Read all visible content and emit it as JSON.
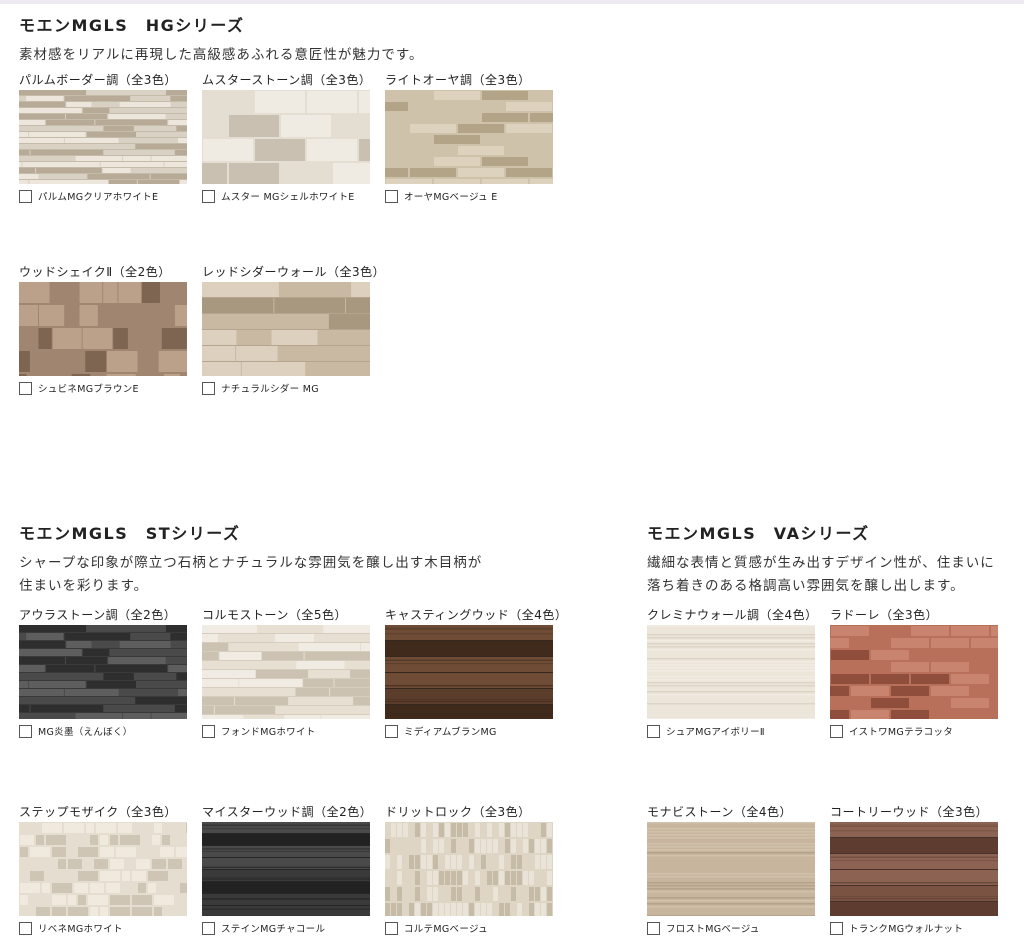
{
  "hg": {
    "title": "モエンMGLS　HGシリーズ",
    "desc_lines": [
      "素材感をリアルに再現した高級感あふれる意匠性が魅力です。"
    ],
    "rows": [
      [
        {
          "label": "パルムボーダー調（全3色）",
          "product": "パルムMGクリアホワイトE",
          "pattern": "palm",
          "colors": [
            "#d9d1c4",
            "#b7ab98",
            "#ece6dc"
          ]
        },
        {
          "label": "ムスターストーン調（全3色）",
          "product": "ムスター MGシェルホワイトE",
          "pattern": "stone",
          "colors": [
            "#e3ddd2",
            "#c9c0b2",
            "#efeae2"
          ]
        },
        {
          "label": "ライトオーヤ調（全3色）",
          "product": "オーヤMGベージュ E",
          "pattern": "oya",
          "colors": [
            "#cfc2aa",
            "#b3a488",
            "#ddd2bd"
          ]
        }
      ],
      [
        {
          "label": "ウッドシェイクⅡ（全2色）",
          "product": "シュビネMGブラウンE",
          "pattern": "shake",
          "colors": [
            "#a08670",
            "#7e6552",
            "#bba18a"
          ]
        },
        {
          "label": "レッドシダーウォール（全3色）",
          "product": "ナチュラルシダー MG",
          "pattern": "cedar",
          "colors": [
            "#c9b9a3",
            "#a89880",
            "#ddd0be"
          ]
        }
      ]
    ]
  },
  "st": {
    "title": "モエンMGLS　STシリーズ",
    "desc_lines": [
      "シャープな印象が際立つ石柄とナチュラルな雰囲気を醸し出す木目柄が",
      "住まいを彩ります。"
    ],
    "rows": [
      [
        {
          "label": "アウラストーン調（全2色）",
          "product": "MG炎墨（えんぼく）",
          "pattern": "aura",
          "colors": [
            "#4a4a4a",
            "#2e2e2e",
            "#5e5e5e"
          ]
        },
        {
          "label": "コルモストーン（全5色）",
          "product": "フォンドMGホワイト",
          "pattern": "corumo",
          "colors": [
            "#e6dfd2",
            "#cbc2b2",
            "#f1ece3"
          ]
        },
        {
          "label": "キャスティングウッド（全4色）",
          "product": "ミディアムブランMG",
          "pattern": "casting",
          "colors": [
            "#5a3d2a",
            "#3f2a1c",
            "#6e4c36"
          ]
        }
      ],
      [
        {
          "label": "ステップモザイク（全3色）",
          "product": "リベネMGホワイト",
          "pattern": "mosaic",
          "colors": [
            "#e4ddd0",
            "#cfc5b4",
            "#efe9de"
          ]
        },
        {
          "label": "マイスターウッド調（全2色）",
          "product": "ステインMGチャコール",
          "pattern": "meister",
          "colors": [
            "#3a3a3a",
            "#222222",
            "#4a4a4a"
          ]
        },
        {
          "label": "ドリットロック（全3色）",
          "product": "コルテMGベージュ",
          "pattern": "dolit",
          "colors": [
            "#ded5c5",
            "#c6bba7",
            "#eae3d7"
          ]
        }
      ]
    ]
  },
  "va": {
    "title": "モエンMGLS　VAシリーズ",
    "desc_lines": [
      "繊細な表情と質感が生み出すデザイン性が、住まいに",
      "落ち着きのある格調高い雰囲気を醸し出します。"
    ],
    "rows": [
      [
        {
          "label": "クレミナウォール調（全4色）",
          "product": "シュアMGアイボリーⅡ",
          "pattern": "cremina",
          "colors": [
            "#ebe5da",
            "#d6cebf",
            "#f3efe7"
          ]
        },
        {
          "label": "ラドーレ（全3色）",
          "product": "イストワMGテラコッタ",
          "pattern": "radore",
          "colors": [
            "#b8705a",
            "#8f4e3c",
            "#c98470"
          ]
        }
      ],
      [
        {
          "label": "モナビストーン（全4色）",
          "product": "フロストMGベージュ",
          "pattern": "monabi",
          "colors": [
            "#c7b59e",
            "#ad9a82",
            "#d6c7b2"
          ]
        },
        {
          "label": "コートリーウッド（全3色）",
          "product": "トランクMGウォルナット",
          "pattern": "courtly",
          "colors": [
            "#7a5343",
            "#5e3d30",
            "#8c6353"
          ]
        }
      ]
    ]
  }
}
